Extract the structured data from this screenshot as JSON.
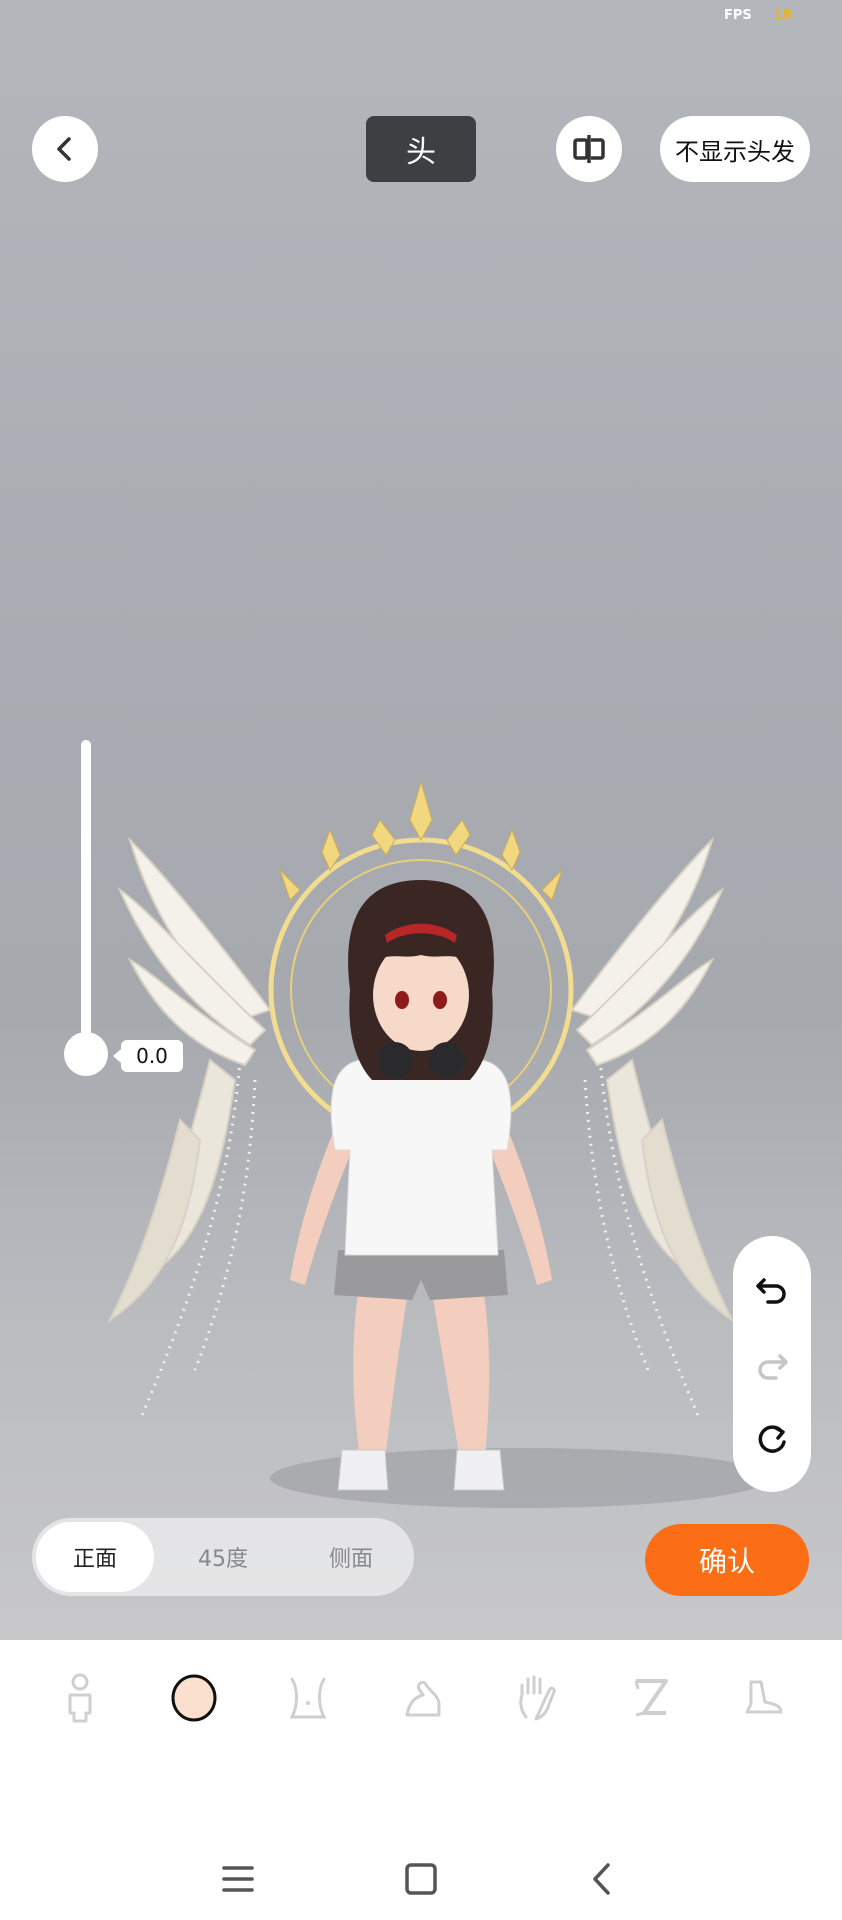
{
  "status": {
    "fps_label": "FPS",
    "fps_value": "18"
  },
  "header": {
    "part_label": "头",
    "hide_hair_label": "不显示头发"
  },
  "slider": {
    "value": "0.0",
    "level": 0.0
  },
  "views": {
    "tabs": [
      "正面",
      "45度",
      "侧面"
    ],
    "selected": "正面"
  },
  "actions": {
    "confirm_label": "确认"
  },
  "categories": [
    {
      "icon": "body-icon",
      "selected": false
    },
    {
      "icon": "head-icon",
      "selected": true
    },
    {
      "icon": "torso-icon",
      "selected": false
    },
    {
      "icon": "arm-icon",
      "selected": false
    },
    {
      "icon": "hand-icon",
      "selected": false
    },
    {
      "icon": "leg-icon",
      "selected": false
    },
    {
      "icon": "foot-icon",
      "selected": false
    }
  ],
  "colors": {
    "accent": "#fb6e15",
    "part_label_bg": "#3d3f42",
    "fps_value": "#f2b21b"
  }
}
